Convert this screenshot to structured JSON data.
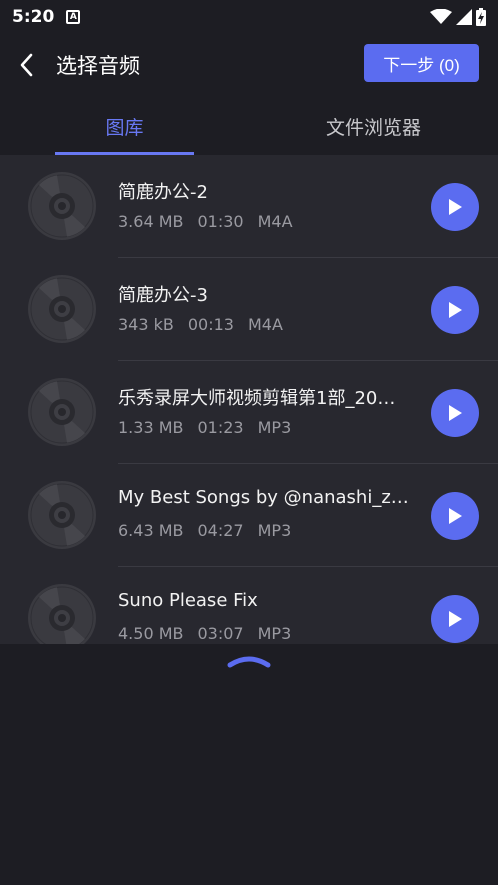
{
  "status": {
    "time": "5:20",
    "a_badge": "A"
  },
  "header": {
    "title": "选择音频",
    "next_label": "下一步 (0)"
  },
  "tabs": [
    {
      "label": "图库",
      "active": true
    },
    {
      "label": "文件浏览器",
      "active": false
    }
  ],
  "items": [
    {
      "title": "简鹿办公-2",
      "size": "3.64 MB",
      "duration": "01:30",
      "format": "M4A"
    },
    {
      "title": "简鹿办公-3",
      "size": "343 kB",
      "duration": "00:13",
      "format": "M4A"
    },
    {
      "title": "乐秀录屏大师视频剪辑第1部_20…",
      "size": "1.33 MB",
      "duration": "01:23",
      "format": "MP3"
    },
    {
      "title": "My Best Songs by @nanashi_zero",
      "size": "6.43 MB",
      "duration": "04:27",
      "format": "MP3"
    },
    {
      "title": "Suno Please Fix",
      "size": "4.50 MB",
      "duration": "03:07",
      "format": "MP3"
    }
  ],
  "colors": {
    "accent": "#5b6cf0",
    "background": "#1d1d23",
    "list_bg": "#28282f"
  },
  "icons": {
    "back": "back-arrow-icon",
    "disc": "disc-icon",
    "play": "play-icon",
    "expand": "chevron-up-icon"
  }
}
